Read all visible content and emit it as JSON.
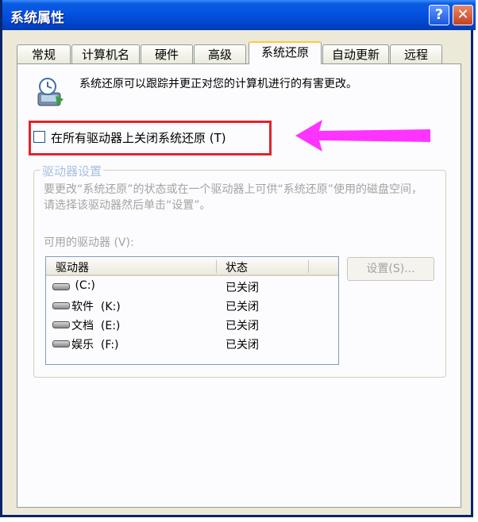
{
  "window": {
    "title": "系统属性",
    "help_glyph": "?",
    "close_glyph": "✕"
  },
  "tabs": [
    {
      "label": "常规"
    },
    {
      "label": "计算机名"
    },
    {
      "label": "硬件"
    },
    {
      "label": "高级"
    },
    {
      "label": "系统还原",
      "active": true
    },
    {
      "label": "自动更新"
    },
    {
      "label": "远程"
    }
  ],
  "intro": {
    "text": "系统还原可以跟踪并更正对您的计算机进行的有害更改。",
    "icon": "system-restore-icon"
  },
  "turn_off": {
    "label": "在所有驱动器上关闭系统还原 (T)",
    "checked": false,
    "highlight_color": "#e0242a",
    "arrow_color": "#ff33ff"
  },
  "drive_settings": {
    "title": "驱动器设置",
    "description": "要更改“系统还原”的状态或在一个驱动器上可供“系统还原”使用的磁盘空间，请选择该驱动器然后单击“设置”。",
    "available_label": "可用的驱动器 (V):",
    "columns": [
      "驱动器",
      "状态"
    ],
    "drives": [
      {
        "name": " (C:)",
        "status": "已关闭"
      },
      {
        "name": "软件  (K:)",
        "status": "已关闭"
      },
      {
        "name": "文档  (E:)",
        "status": "已关闭"
      },
      {
        "name": "娱乐  (F:)",
        "status": "已关闭"
      }
    ],
    "settings_button": "设置(S)..."
  }
}
